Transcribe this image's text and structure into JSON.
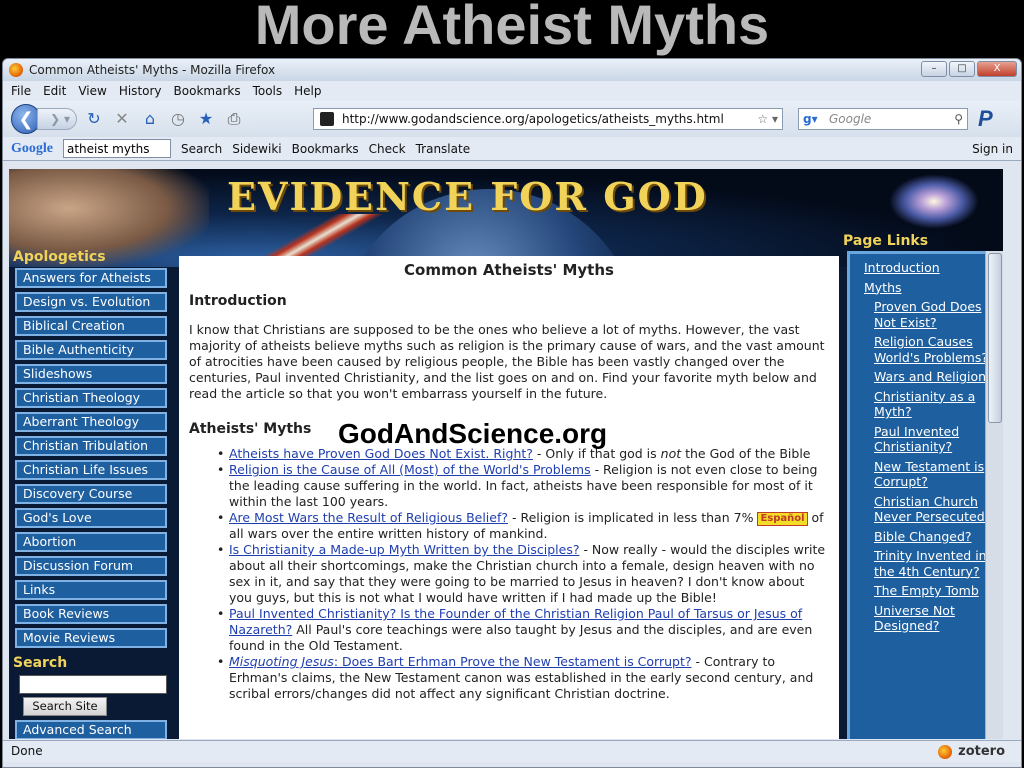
{
  "slide": {
    "title": "More Atheist Myths"
  },
  "window": {
    "title": "Common Atheists' Myths - Mozilla Firefox",
    "buttons": [
      "–",
      "□",
      "X"
    ]
  },
  "menu": [
    "File",
    "Edit",
    "View",
    "History",
    "Bookmarks",
    "Tools",
    "Help"
  ],
  "navbar": {
    "url": "http://www.godandscience.org/apologetics/atheists_myths.html",
    "search_placeholder": "Google"
  },
  "googlebar": {
    "logo": "Google",
    "query": "atheist myths",
    "items": [
      "Search",
      "Sidewiki",
      "Bookmarks",
      "Check",
      "Translate"
    ],
    "signin": "Sign in"
  },
  "site": {
    "title": "EVIDENCE FOR GOD",
    "left_heading": "Apologetics",
    "right_heading": "Page Links",
    "search_heading": "Search",
    "search_button": "Search Site",
    "advanced_search": "Advanced Search",
    "nav": [
      "Answers for Atheists",
      "Design vs. Evolution",
      "Biblical Creation",
      "Bible Authenticity",
      "Slideshows",
      "Christian Theology",
      "Aberrant Theology",
      "Christian Tribulation",
      "Christian Life Issues",
      "Discovery Course",
      "God's Love",
      "Abortion",
      "Discussion Forum",
      "Links",
      "Book Reviews",
      "Movie Reviews"
    ]
  },
  "article": {
    "title": "Common Atheists' Myths",
    "intro_heading": "Introduction",
    "intro": "I know that Christians are supposed to be the ones who believe a lot of myths. However, the vast majority of atheists believe myths such as religion is the primary cause of wars, and the vast amount of atrocities have been caused by religious people, the Bible has been vastly changed over the centuries, Paul invented Christianity, and the list goes on and on. Find your favorite myth below and read the article so that you won't embarrass yourself in the future.",
    "myths_heading": "Atheists' Myths",
    "overlay": "GodAndScience.org",
    "espanol": "Español",
    "myths": [
      {
        "link": "Atheists have Proven God Does Not Exist. Right?",
        "pre": " - Only if that god is ",
        "em": "not",
        "post": " the God of the Bible"
      },
      {
        "link": "Religion is the Cause of All (Most) of the World's Problems",
        "text": " - Religion is not even close to being the leading cause suffering in the world. In fact, atheists have been responsible for most of it within the last 100 years."
      },
      {
        "link": "Are Most Wars the Result of Religious Belief?",
        "text": " - Religion is implicated in less than 7%",
        "text2": " of all wars over the entire written history of mankind."
      },
      {
        "link": "Is Christianity a Made-up Myth Written by the Disciples?",
        "text": " - Now really - would the disciples write about all their shortcomings, make the Christian church into a female, design heaven with no sex in it, and say that they were going to be married to Jesus in heaven? I don't know about you guys, but this is not what I would have written if I had made up the Bible!"
      },
      {
        "link": "Paul Invented Christianity? Is the Founder of the Christian Religion Paul of Tarsus or Jesus of Nazareth?",
        "text": " All Paul's core teachings were also taught by Jesus and the disciples, and are even found in the Old Testament."
      },
      {
        "link_em": "Misquoting Jesus",
        "link": ": Does Bart Erhman Prove the New Testament is Corrupt?",
        "text": " - Contrary to Erhman's claims, the New Testament canon was established in the early second century, and scribal errors/changes did not affect any significant Christian doctrine."
      }
    ]
  },
  "pagelinks": {
    "top": [
      "Introduction",
      "Myths"
    ],
    "sub": [
      "Proven God Does Not Exist?",
      "Religion Causes World's Problems?",
      "Wars and Religion",
      "Christianity as a Myth?",
      "Paul Invented Christianity?",
      "New Testament is Corrupt?",
      "Christian Church Never Persecuted?",
      "Bible Changed?",
      "Trinity Invented in the 4th Century?",
      "The Empty Tomb",
      "Universe Not Designed?"
    ]
  },
  "status": {
    "text": "Done",
    "zotero": "zotero"
  }
}
